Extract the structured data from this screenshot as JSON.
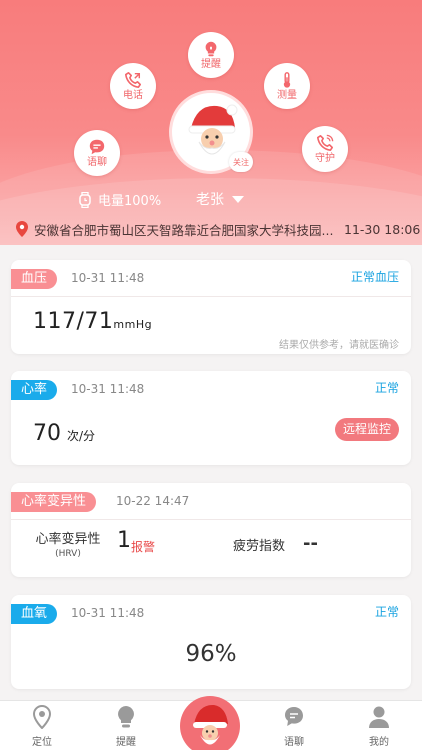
{
  "header": {
    "quick_actions": [
      {
        "label": "提醒",
        "icon": "bulb-icon"
      },
      {
        "label": "电话",
        "icon": "phone-icon"
      },
      {
        "label": "测量",
        "icon": "thermometer-icon"
      },
      {
        "label": "语聊",
        "icon": "chat-icon"
      },
      {
        "label": "守护",
        "icon": "guard-phone-icon"
      }
    ],
    "follow_tag": "关注",
    "battery_label": "电量100%",
    "user_name": "老张",
    "location": {
      "address": "安徽省合肥市蜀山区天智路靠近合肥国家大学科技园...",
      "time": "11-30 18:06"
    }
  },
  "cards": {
    "blood_pressure": {
      "tag": "血压",
      "time": "10-31 11:48",
      "status": "正常血压",
      "systolic": "117",
      "separator": "/",
      "diastolic": "71",
      "unit": "mmHg",
      "note": "结果仅供参考，请就医确诊"
    },
    "heart_rate": {
      "tag": "心率",
      "time": "10-31 11:48",
      "status": "正常",
      "value": "70",
      "unit": "次/分",
      "button": "远程监控"
    },
    "hrv": {
      "tag": "心率变异性",
      "time": "10-22 14:47",
      "label": "心率变异性",
      "sublabel": "(HRV)",
      "value": "1",
      "alarm": "报警",
      "fatigue_label": "疲劳指数",
      "fatigue_value": "--"
    },
    "spo2": {
      "tag": "血氧",
      "time": "10-31 11:48",
      "status": "正常",
      "value": "96%"
    }
  },
  "tabbar": {
    "items": [
      {
        "label": "定位",
        "icon": "location-icon"
      },
      {
        "label": "提醒",
        "icon": "bulb-icon"
      },
      {
        "label": "语聊",
        "icon": "chat-icon"
      },
      {
        "label": "我的",
        "icon": "profile-icon"
      }
    ]
  },
  "colors": {
    "accent": "#f87c7c",
    "tag_pink": "#f98f93",
    "tag_blue": "#1aabeb",
    "status_blue": "#1aa3e0",
    "alarm_red": "#e84848"
  }
}
